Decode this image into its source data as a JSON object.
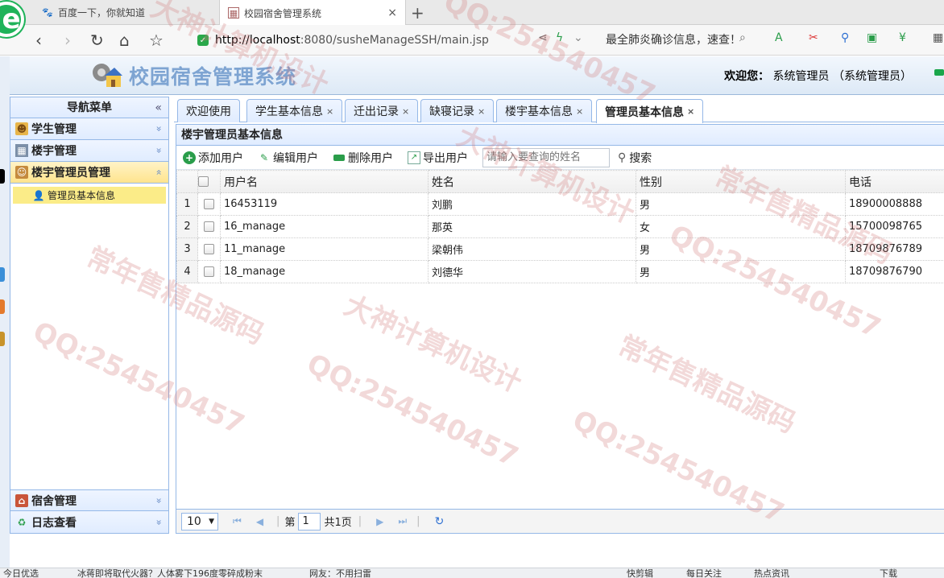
{
  "browser": {
    "tabs": [
      {
        "title": "百度一下，你就知道",
        "icon": "paw-icon",
        "active": false
      },
      {
        "title": "校园宿舍管理系统",
        "icon": "page-icon",
        "active": true,
        "close": "×"
      }
    ],
    "new_tab": "+",
    "url_host": "http://localhost",
    "url_rest": ":8080/susheManageSSH/main.jsp",
    "news_text": "最全肺炎确诊信息，速查！",
    "status": {
      "left": "今日优选",
      "news": "冰蒋即将取代火器？人体雾下196度零碎成粉末",
      "source": "网友：不用扫雷",
      "right1": "快剪辑",
      "right2": "每日关注",
      "right3": "热点资讯",
      "right4": "下载"
    }
  },
  "app": {
    "title": "校园宿舍管理系统",
    "welcome_label": "欢迎您：",
    "welcome_user": "系统管理员 （系统管理员）"
  },
  "nav": {
    "title": "导航菜单",
    "collapse": "«",
    "sections": [
      {
        "label": "学生管理",
        "icon": "students-icon",
        "chevron": "»"
      },
      {
        "label": "楼宇管理",
        "icon": "building-icon",
        "chevron": "»"
      },
      {
        "label": "楼宇管理员管理",
        "icon": "admins-icon",
        "chevron": "«"
      }
    ],
    "sub_item": "管理员基本信息",
    "bottom_sections": [
      {
        "label": "宿舍管理",
        "icon": "dorm-icon",
        "chevron": "»"
      },
      {
        "label": "日志查看",
        "icon": "log-icon",
        "chevron": "»"
      }
    ]
  },
  "tabs": [
    {
      "label": "欢迎使用",
      "close": ""
    },
    {
      "label": "学生基本信息",
      "close": "×"
    },
    {
      "label": "迁出记录",
      "close": "×"
    },
    {
      "label": "缺寝记录",
      "close": "×"
    },
    {
      "label": "楼宇基本信息",
      "close": "×"
    },
    {
      "label": "管理员基本信息",
      "close": "×"
    }
  ],
  "panel": {
    "title": "楼宇管理员基本信息",
    "tools": {
      "add": "添加用户",
      "edit": "编辑用户",
      "delete": "删除用户",
      "export": "导出用户",
      "search_placeholder": "请输入要查询的姓名",
      "search": "搜索"
    },
    "columns": [
      "用户名",
      "姓名",
      "性别",
      "电话"
    ],
    "rows": [
      {
        "n": "1",
        "username": "16453119",
        "name": "刘鹏",
        "gender": "男",
        "phone": "18900008888"
      },
      {
        "n": "2",
        "username": "16_manage",
        "name": "那英",
        "gender": "女",
        "phone": "15700098765"
      },
      {
        "n": "3",
        "username": "11_manage",
        "name": "梁朝伟",
        "gender": "男",
        "phone": "18709876789"
      },
      {
        "n": "4",
        "username": "18_manage",
        "name": "刘德华",
        "gender": "男",
        "phone": "18709876790"
      }
    ],
    "pager": {
      "page_size": "10",
      "page_label": "第",
      "page": "1",
      "total": "共1页"
    }
  },
  "watermarks": [
    "QQ:254540457",
    "大神计算机设计",
    "常年售精品源码"
  ]
}
